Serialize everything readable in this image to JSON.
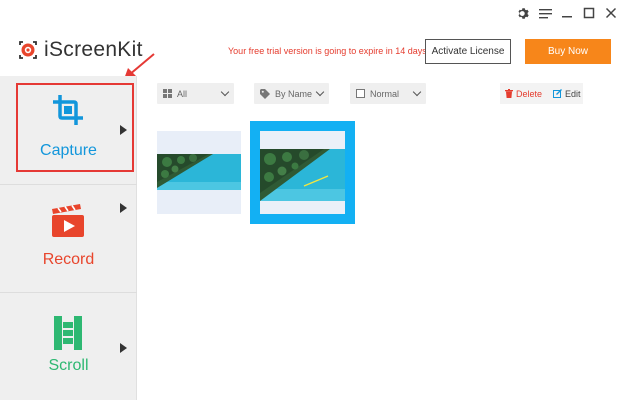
{
  "window": {
    "controls": [
      "gear-icon",
      "menu-icon",
      "minimize-icon",
      "maximize-icon",
      "close-icon"
    ]
  },
  "header": {
    "logo_text": "iScreenKit",
    "trial_notice": "Your free trial version is going to expire in 14 days!",
    "activate_label": "Activate License",
    "buy_label": "Buy Now"
  },
  "sidebar": {
    "items": [
      {
        "label": "Capture",
        "icon": "capture-icon",
        "selected": true,
        "color": "#1296db"
      },
      {
        "label": "Record",
        "icon": "record-icon",
        "selected": false,
        "color": "#e8452c"
      },
      {
        "label": "Scroll",
        "icon": "scroll-icon",
        "selected": false,
        "color": "#2eb872"
      }
    ]
  },
  "toolbar": {
    "filter": {
      "icon": "grid-icon",
      "value": "All"
    },
    "sort": {
      "icon": "tag-icon",
      "value": "By Name"
    },
    "view": {
      "icon": "checkbox-icon",
      "value": "Normal"
    },
    "delete_label": "Delete",
    "edit_label": "Edit"
  },
  "gallery": {
    "items": [
      {
        "selected": false
      },
      {
        "selected": true
      }
    ]
  },
  "colors": {
    "accent_blue": "#13b0f3",
    "buy_orange": "#f7861a",
    "alert_red": "#e53c2e",
    "annotation_red": "#e53935"
  }
}
